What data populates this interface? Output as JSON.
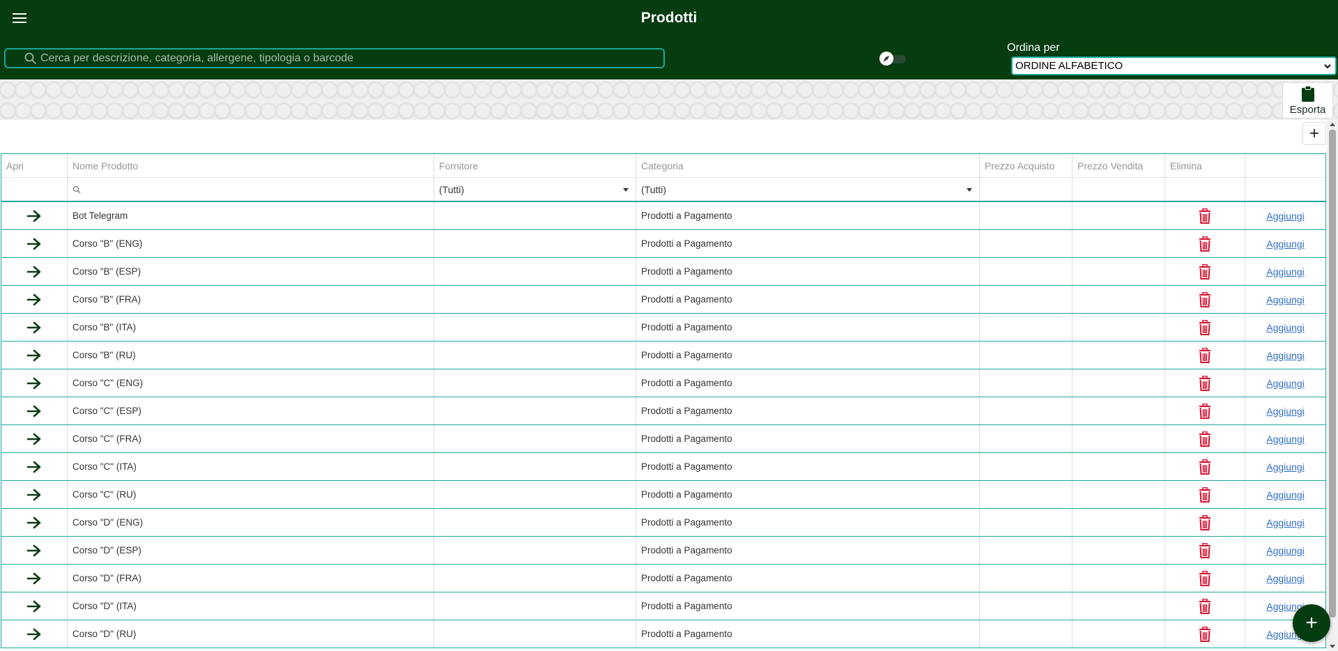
{
  "header": {
    "title": "Prodotti",
    "search_placeholder": "Cerca per descrizione, categoria, allergene, tipologia o barcode",
    "sort_label": "Ordina per",
    "sort_value": "ORDINE ALFABETICO"
  },
  "toolbar": {
    "export_label": "Esporta"
  },
  "table": {
    "columns": [
      "Apri",
      "Nome Prodotto",
      "Fornitore",
      "Categoria",
      "Prezzo Acquisto",
      "Prezzo Vendita",
      "Elimina",
      ""
    ],
    "filters": {
      "fornitore": "(Tutti)",
      "categoria": "(Tutti)"
    },
    "add_link_label": "Aggiungi",
    "rows": [
      {
        "nome": "Bot Telegram",
        "fornitore": "",
        "categoria": "Prodotti a Pagamento",
        "prezzo_acquisto": "",
        "prezzo_vendita": ""
      },
      {
        "nome": "Corso \"B\" (ENG)",
        "fornitore": "",
        "categoria": "Prodotti a Pagamento",
        "prezzo_acquisto": "",
        "prezzo_vendita": ""
      },
      {
        "nome": "Corso \"B\" (ESP)",
        "fornitore": "",
        "categoria": "Prodotti a Pagamento",
        "prezzo_acquisto": "",
        "prezzo_vendita": ""
      },
      {
        "nome": "Corso \"B\" (FRA)",
        "fornitore": "",
        "categoria": "Prodotti a Pagamento",
        "prezzo_acquisto": "",
        "prezzo_vendita": ""
      },
      {
        "nome": "Corso \"B\" (ITA)",
        "fornitore": "",
        "categoria": "Prodotti a Pagamento",
        "prezzo_acquisto": "",
        "prezzo_vendita": ""
      },
      {
        "nome": "Corso \"B\" (RU)",
        "fornitore": "",
        "categoria": "Prodotti a Pagamento",
        "prezzo_acquisto": "",
        "prezzo_vendita": ""
      },
      {
        "nome": "Corso \"C\" (ENG)",
        "fornitore": "",
        "categoria": "Prodotti a Pagamento",
        "prezzo_acquisto": "",
        "prezzo_vendita": ""
      },
      {
        "nome": "Corso \"C\" (ESP)",
        "fornitore": "",
        "categoria": "Prodotti a Pagamento",
        "prezzo_acquisto": "",
        "prezzo_vendita": ""
      },
      {
        "nome": "Corso \"C\" (FRA)",
        "fornitore": "",
        "categoria": "Prodotti a Pagamento",
        "prezzo_acquisto": "",
        "prezzo_vendita": ""
      },
      {
        "nome": "Corso \"C\" (ITA)",
        "fornitore": "",
        "categoria": "Prodotti a Pagamento",
        "prezzo_acquisto": "",
        "prezzo_vendita": ""
      },
      {
        "nome": "Corso \"C\" (RU)",
        "fornitore": "",
        "categoria": "Prodotti a Pagamento",
        "prezzo_acquisto": "",
        "prezzo_vendita": ""
      },
      {
        "nome": "Corso \"D\" (ENG)",
        "fornitore": "",
        "categoria": "Prodotti a Pagamento",
        "prezzo_acquisto": "",
        "prezzo_vendita": ""
      },
      {
        "nome": "Corso \"D\" (ESP)",
        "fornitore": "",
        "categoria": "Prodotti a Pagamento",
        "prezzo_acquisto": "",
        "prezzo_vendita": ""
      },
      {
        "nome": "Corso \"D\" (FRA)",
        "fornitore": "",
        "categoria": "Prodotti a Pagamento",
        "prezzo_acquisto": "",
        "prezzo_vendita": ""
      },
      {
        "nome": "Corso \"D\" (ITA)",
        "fornitore": "",
        "categoria": "Prodotti a Pagamento",
        "prezzo_acquisto": "",
        "prezzo_vendita": ""
      },
      {
        "nome": "Corso \"D\" (RU)",
        "fornitore": "",
        "categoria": "Prodotti a Pagamento",
        "prezzo_acquisto": "",
        "prezzo_vendita": ""
      }
    ]
  },
  "colors": {
    "header_bg": "#053c10",
    "accent": "#1ba79c",
    "arrow": "#0b3d13",
    "trash": "#d8102e",
    "link": "#2f6ec7"
  },
  "icons": {
    "menu": "hamburger-icon",
    "search": "search-icon",
    "toggle": "rocket-icon",
    "export": "clipboard-icon",
    "add": "plus-icon",
    "open": "arrow-right-icon",
    "delete": "trash-icon"
  }
}
